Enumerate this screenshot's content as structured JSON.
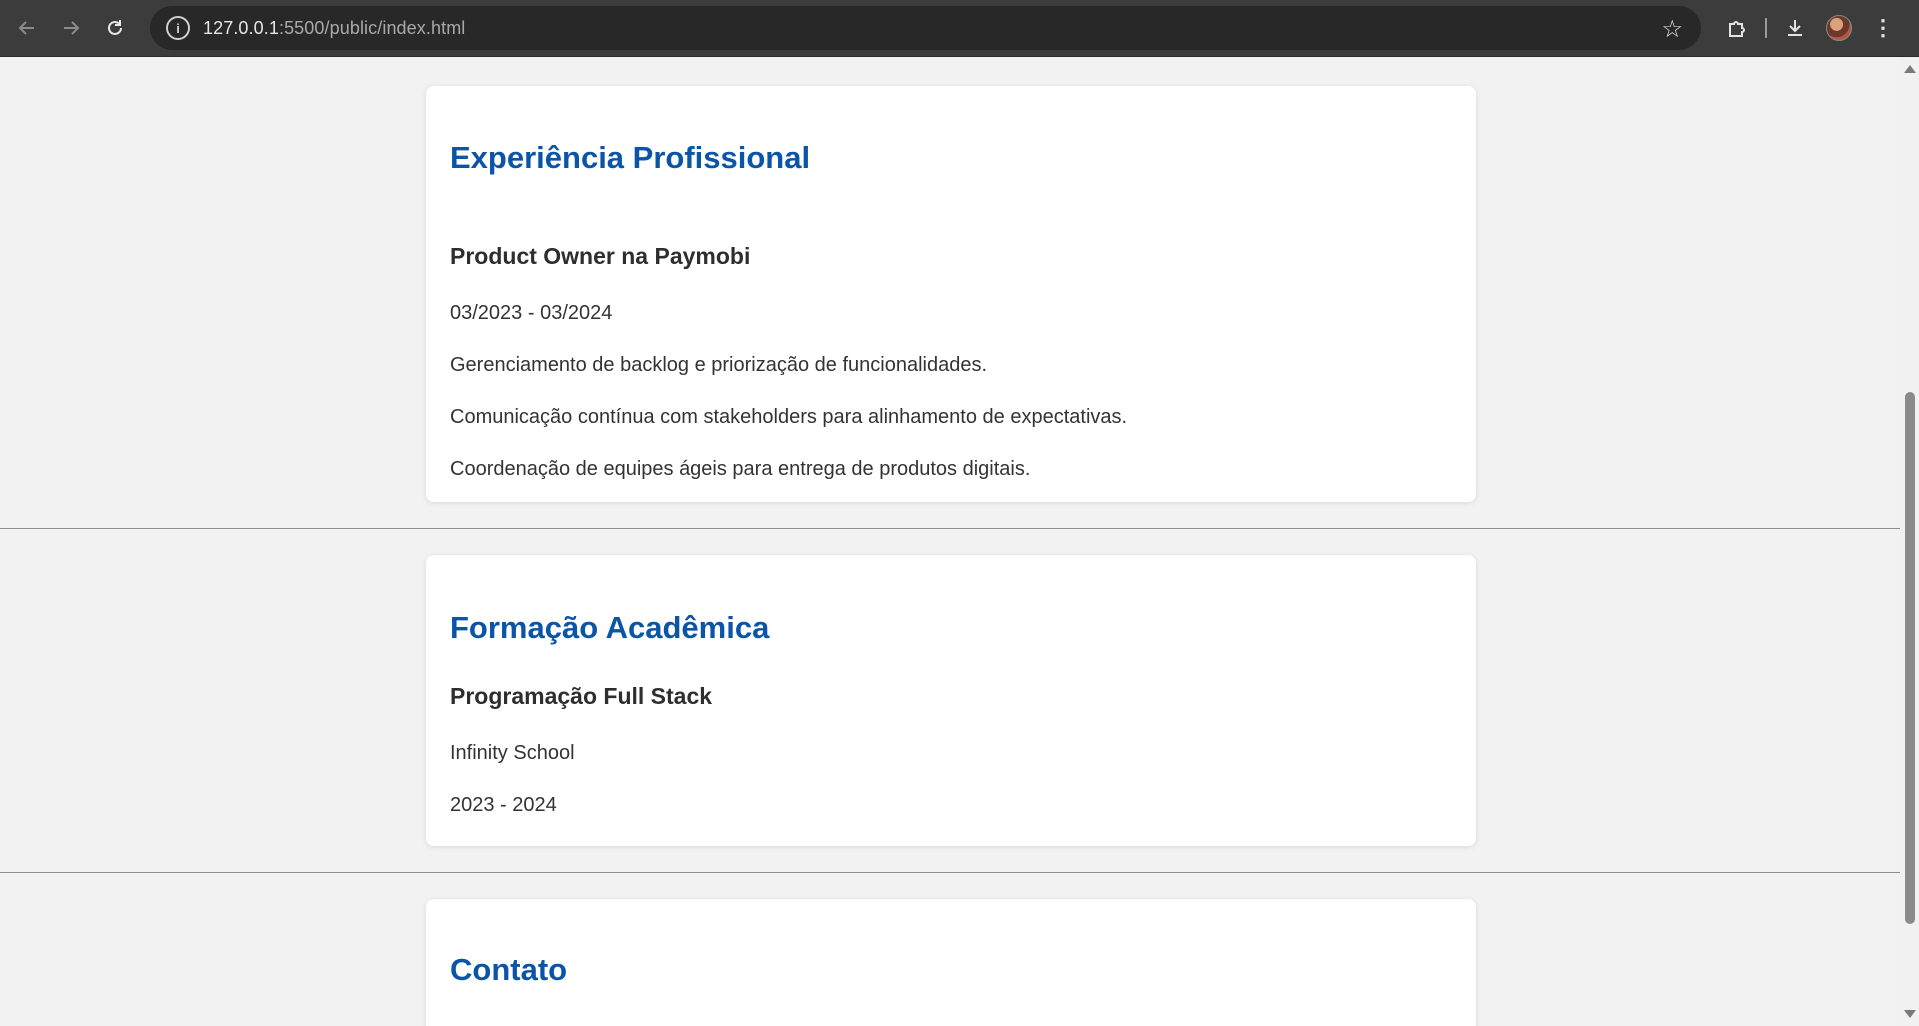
{
  "browser": {
    "url_host": "127.0.0.1",
    "url_rest": ":5500/public/index.html",
    "icons": {
      "back": "arrow-left-icon",
      "forward": "arrow-right-icon",
      "reload": "reload-icon",
      "site_info": "info-icon",
      "bookmark": "star-icon",
      "extensions": "puzzle-icon",
      "downloads": "download-icon",
      "profile": "avatar",
      "menu": "kebab-menu-icon"
    }
  },
  "sections": {
    "experience": {
      "title": "Experiência Profissional",
      "job_title": "Product Owner na Paymobi",
      "period": "03/2023 - 03/2024",
      "items": [
        "Gerenciamento de backlog e priorização de funcionalidades.",
        "Comunicação contínua com stakeholders para alinhamento de expectativas.",
        "Coordenação de equipes ágeis para entrega de produtos digitais."
      ]
    },
    "education": {
      "title": "Formação Acadêmica",
      "course": "Programação Full Stack",
      "institution": "Infinity School",
      "period": "2023 - 2024"
    },
    "contact": {
      "title": "Contato"
    }
  },
  "colors": {
    "heading": "#0b55a8",
    "page_background": "#f2f2f2",
    "card_background": "#ffffff",
    "chrome": "#3c3c3c"
  }
}
